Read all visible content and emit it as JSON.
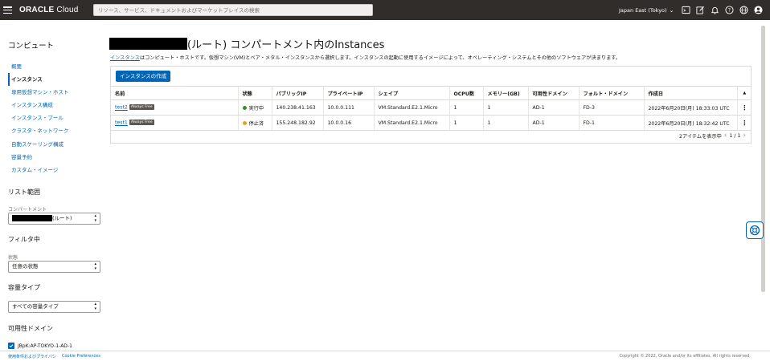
{
  "topbar": {
    "brand_main": "ORACLE",
    "brand_sub": "Cloud",
    "search_placeholder": "リソース、サービス、ドキュメントおよびマーケットプレイスの検索",
    "region": "Japan East (Tokyo)"
  },
  "sidebar": {
    "section_title": "コンピュート",
    "nav": [
      "概要",
      "インスタンス",
      "専用仮想マシン・ホスト",
      "インスタンス構成",
      "インスタンス・プール",
      "クラスタ・ネットワーク",
      "自動スケーリング構成",
      "容量予約",
      "カスタム・イメージ"
    ],
    "list_scope_title": "リスト範囲",
    "compartment_label": "コンパートメント",
    "compartment_suffix": "(ルート)",
    "filter_title": "フィルタ中",
    "state_label": "状態",
    "state_value": "任意の状態",
    "capacity_title": "容量タイプ",
    "capacity_value": "すべての容量タイプ",
    "ad_title": "可用性ドメイン",
    "ad_checkbox": "JBpK:AP-TOKYO-1-AD-1"
  },
  "main": {
    "title_suffix": "(ルート) コンパートメント内のInstances",
    "desc_link": "インスタンス",
    "desc_rest": "はコンピュート・ホストです。仮想マシン(VM)とベア・メタル・インスタンスから選択します。インスタンスの起動に使用するイメージによって、オペレーティング・システムとその他のソフトウェアが決まります。",
    "create_button": "インスタンスの作成",
    "columns": [
      "名前",
      "状態",
      "パブリックIP",
      "プライベートIP",
      "シェイプ",
      "OCPU数",
      "メモリー(GB)",
      "可用性ドメイン",
      "フォルト・ドメイン",
      "作成日"
    ],
    "rows": [
      {
        "name": "test2",
        "badge": "Always Free",
        "state": "実行中",
        "state_color": "#3c8a2e",
        "public_ip": "140.238.41.163",
        "private_ip": "10.0.0.111",
        "shape": "VM.Standard.E2.1.Micro",
        "ocpu": "1",
        "memory": "1",
        "ad": "AD-1",
        "fd": "FD-3",
        "created": "2022年6月20日(月) 18:33:03 UTC"
      },
      {
        "name": "test1",
        "badge": "Always Free",
        "state": "停止済",
        "state_color": "#e5a11c",
        "public_ip": "155.248.182.92",
        "private_ip": "10.0.0.16",
        "shape": "VM.Standard.E2.1.Micro",
        "ocpu": "1",
        "memory": "1",
        "ad": "AD-1",
        "fd": "FD-1",
        "created": "2022年6月20日(月) 18:32:42 UTC"
      }
    ],
    "pager_count": "2アイテムを表示中",
    "pager_page": "1 / 1"
  },
  "footer": {
    "terms": "使用条件およびプライバシ",
    "cookie": "Cookie Preferences",
    "copyright": "Copyright © 2022, Oracle and/or its affiliates. All rights reserved."
  },
  "colors": {
    "topbar": "#312d2a",
    "accent": "#0067b8",
    "running": "#3c8a2e",
    "stopped": "#e5a11c"
  },
  "icons": [
    "hamburger-icon",
    "cloud-shell-icon",
    "edit-icon",
    "bell-icon",
    "help-icon",
    "globe-icon",
    "user-icon",
    "lifebuoy-icon"
  ]
}
